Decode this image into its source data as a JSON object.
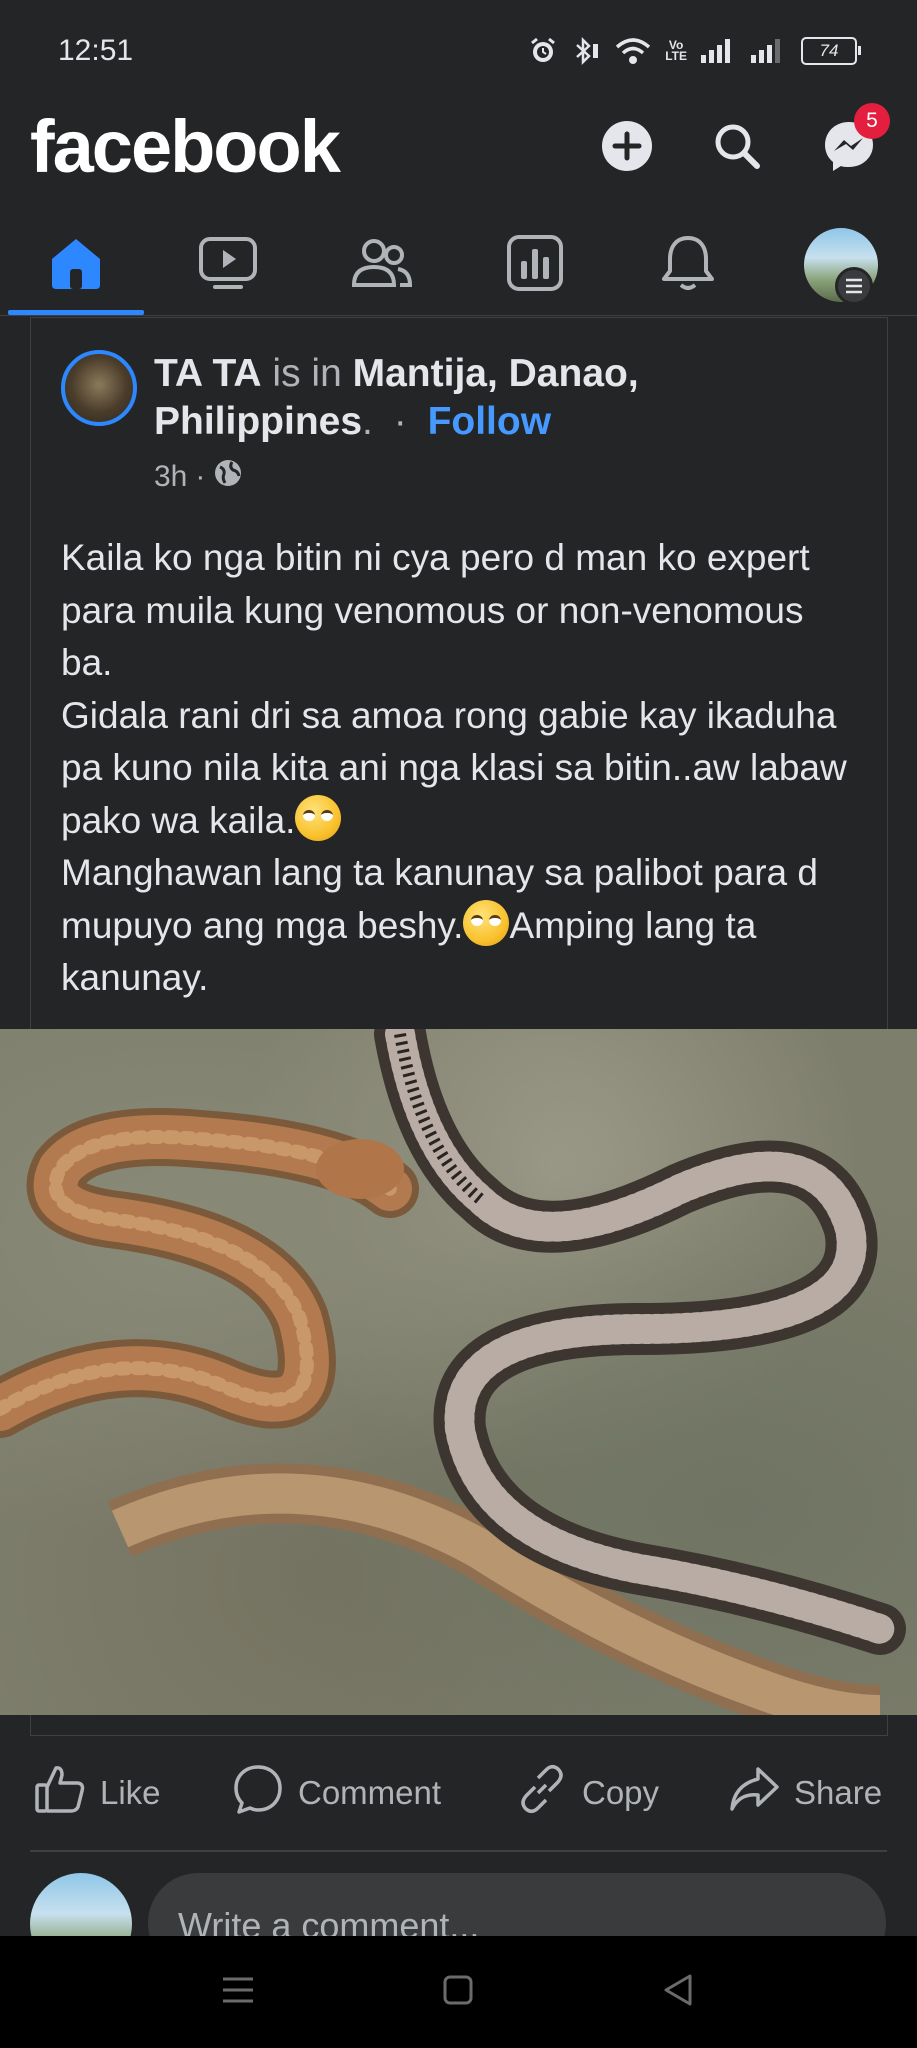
{
  "status_bar": {
    "time": "12:51",
    "volte_top": "Vo",
    "volte_bottom": "LTE",
    "battery": "74"
  },
  "header": {
    "logo": "facebook",
    "messenger_badge": "5"
  },
  "tabs": [
    {
      "name": "home",
      "icon": "home-icon",
      "active": true
    },
    {
      "name": "video",
      "icon": "video-icon",
      "active": false
    },
    {
      "name": "friends",
      "icon": "friends-icon",
      "active": false
    },
    {
      "name": "feeds",
      "icon": "chart-icon",
      "active": false
    },
    {
      "name": "notifications",
      "icon": "bell-icon",
      "active": false
    },
    {
      "name": "profile-menu",
      "icon": "avatar",
      "active": false
    }
  ],
  "post": {
    "author": "TA TA",
    "is_in": "is in",
    "location": "Mantija, Danao, Philippines",
    "period": ".",
    "separator": "·",
    "follow_label": "Follow",
    "time_ago": "3h",
    "meta_sep": "·",
    "audience_icon": "globe-icon",
    "text_lines": [
      "Kaila ko nga bitin ni cya pero d man ko expert para muila kung venomous or non-venomous ba.",
      "Gidala rani dri sa amoa rong gabie kay ikaduha pa kuno nila kita ani nga klasi sa bitin..aw labaw pako wa kaila.",
      "Manghawan lang ta kanunay sa palibot para d mupuyo ang mga beshy.",
      "Amping lang ta kanunay."
    ],
    "emoji": "face-with-rolling-eyes"
  },
  "actions": {
    "like": "Like",
    "comment": "Comment",
    "copy": "Copy",
    "share": "Share"
  },
  "comment_box": {
    "placeholder": "Write a comment..."
  },
  "colors": {
    "background": "#242526",
    "accent": "#2d88ff",
    "follow": "#4599ff",
    "badge": "#e41e3f"
  }
}
